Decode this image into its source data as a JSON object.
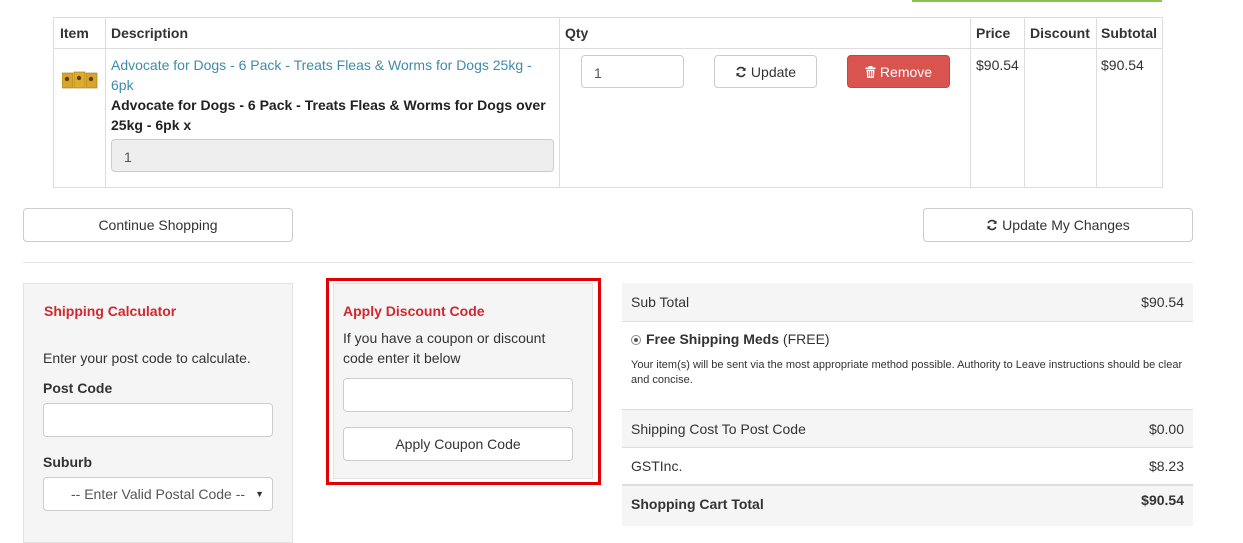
{
  "table": {
    "headers": {
      "item": "Item",
      "description": "Description",
      "qty": "Qty",
      "price": "Price",
      "discount": "Discount",
      "subtotal": "Subtotal"
    },
    "row": {
      "product_link": "Advocate for Dogs - 6 Pack - Treats Fleas & Worms for Dogs 25kg - 6pk",
      "product_name": "Advocate for Dogs - 6 Pack - Treats Fleas & Worms for Dogs over 25kg - 6pk x",
      "product_qty_readonly": "1",
      "qty_value": "1",
      "update_label": "Update",
      "remove_label": "Remove",
      "price": "$90.54",
      "discount": "",
      "subtotal": "$90.54"
    }
  },
  "actions": {
    "continue_label": "Continue Shopping",
    "update_changes_label": "Update My Changes"
  },
  "shipping_calculator": {
    "title": "Shipping Calculator",
    "instructions": "Enter your post code to calculate.",
    "post_code_label": "Post Code",
    "suburb_label": "Suburb",
    "suburb_selected": "-- Enter Valid Postal Code --"
  },
  "discount": {
    "title": "Apply Discount Code",
    "text": "If you have a coupon or discount code enter it below",
    "apply_label": "Apply Coupon Code"
  },
  "summary": {
    "sub_total_label": "Sub Total",
    "sub_total": "$90.54",
    "shipping_name": "Free Shipping Meds",
    "shipping_tag": "(FREE)",
    "shipping_note": "Your item(s) will be sent via the most appropriate method possible. Authority to Leave instructions should be clear and concise.",
    "shipping_cost_label": "Shipping Cost To Post Code",
    "shipping_cost": "$0.00",
    "gst_label": "GSTInc.",
    "gst": "$8.23",
    "total_label": "Shopping Cart Total",
    "total": "$90.54"
  },
  "icons": {
    "refresh": "refresh-icon",
    "trash": "trash-icon",
    "product": "product-thumbnail"
  },
  "colors": {
    "link": "#3f8bab",
    "danger": "#d9534f",
    "panel_title": "#d0282e",
    "highlight": "#e00000"
  }
}
